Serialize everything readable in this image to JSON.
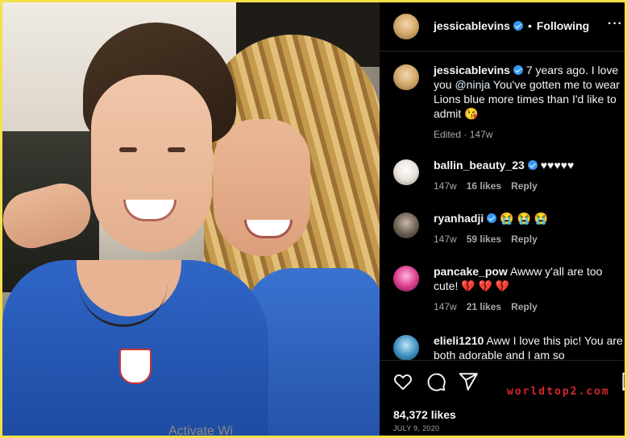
{
  "post": {
    "author": "jessicablevins",
    "separator": "•",
    "follow_status": "Following",
    "more_label": "···"
  },
  "caption": {
    "author": "jessicablevins",
    "text_before": " 7 years ago. I love you ",
    "mention": "@ninja",
    "text_after": " You've gotten me to wear Lions blue more times than I'd like to admit ",
    "emoji": "😘",
    "edited": "Edited",
    "meta_sep": "·",
    "age": "147w"
  },
  "comments": [
    {
      "user": "ballin_beauty_23",
      "verified": true,
      "text": "♥♥♥♥♥",
      "age": "147w",
      "likes": "16 likes",
      "reply": "Reply"
    },
    {
      "user": "ryanhadji",
      "verified": true,
      "text": "😭 😭 😭",
      "age": "147w",
      "likes": "59 likes",
      "reply": "Reply"
    },
    {
      "user": "pancake_pow",
      "verified": false,
      "text": "Awww y'all are too cute! ",
      "hearts": "💔 💔 💔",
      "age": "147w",
      "likes": "21 likes",
      "reply": "Reply"
    },
    {
      "user": "elieli1210",
      "verified": false,
      "text": "Aww I love this pic! You are both adorable and I am so"
    }
  ],
  "footer": {
    "likes": "84,372 likes",
    "date": "JULY 9, 2020",
    "watermark": "worldtop2.com"
  },
  "overlay": {
    "activate": "Activate Wi"
  },
  "colors": {
    "frame_border": "#f3e04a",
    "panel_bg": "#000000",
    "verified_badge": "#3897f0",
    "watermark": "#d7262c"
  }
}
